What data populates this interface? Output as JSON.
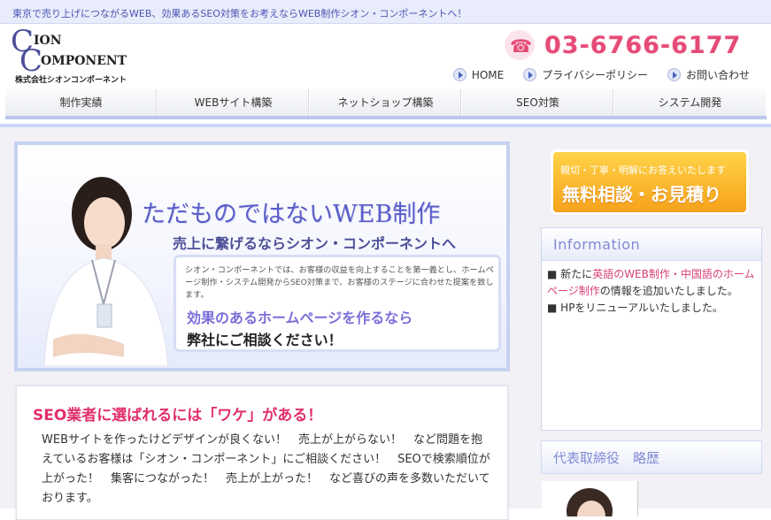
{
  "topbar": {
    "tagline": "東京で売り上げにつながるWEB、効果あるSEO対策をお考えならWEB制作シオン・コンポーネントへ！"
  },
  "logo": {
    "line1": "ION",
    "line2": "OMPONENT",
    "company": "株式会社シオンコンポーネント"
  },
  "phone": {
    "number": "03-6766-6177"
  },
  "toplinks": [
    {
      "label": "HOME"
    },
    {
      "label": "プライバシーポリシー"
    },
    {
      "label": "お問い合わせ"
    }
  ],
  "nav": [
    {
      "label": "制作実績"
    },
    {
      "label": "WEBサイト構築"
    },
    {
      "label": "ネットショップ構築"
    },
    {
      "label": "SEO対策"
    },
    {
      "label": "システム開発"
    }
  ],
  "hero": {
    "headline": "ただものではないWEB制作",
    "subhead": "売上に繋げるならシオン・コンポーネントへ",
    "description": "シオン・コンポーネントでは、お客様の収益を向上することを第一義とし、ホームページ制作・システム開発からSEO対策まで、お客様のステージに合わせた提案を致します。",
    "lead1": "効果のあるホームページを作るなら",
    "lead2": "弊社にご相談ください！"
  },
  "seo": {
    "title": "SEO業者に選ばれるには「ワケ」がある！",
    "body": "WEBサイトを作ったけどデザインが良くない！　売上が上がらない！　など問題を抱えているお客様は「シオン・コンポーネント」にご相談ください！　SEOで検索順位が上がった！　集客につながった！　売上が上がった！　など喜びの声を多数いただいております。"
  },
  "consult": {
    "small": "親切・丁寧・明解にお答えいたします",
    "big": "無料相談・お見積り"
  },
  "information": {
    "title": "Information",
    "items": [
      {
        "bullet": "■",
        "prefix": "新たに",
        "link": "英語のWEB制作・中国語のホームページ制作",
        "suffix": "の情報を追加いたしました。"
      },
      {
        "bullet": "■",
        "prefix": "HPをリニューアルいたしました。",
        "link": "",
        "suffix": ""
      }
    ]
  },
  "representative": {
    "title": "代表取締役　略歴"
  },
  "colors": {
    "accent": "#e54b76",
    "nav_border": "#b9c7ef",
    "brand_blue": "#5a5dc8",
    "orange": "#f6a21b"
  }
}
